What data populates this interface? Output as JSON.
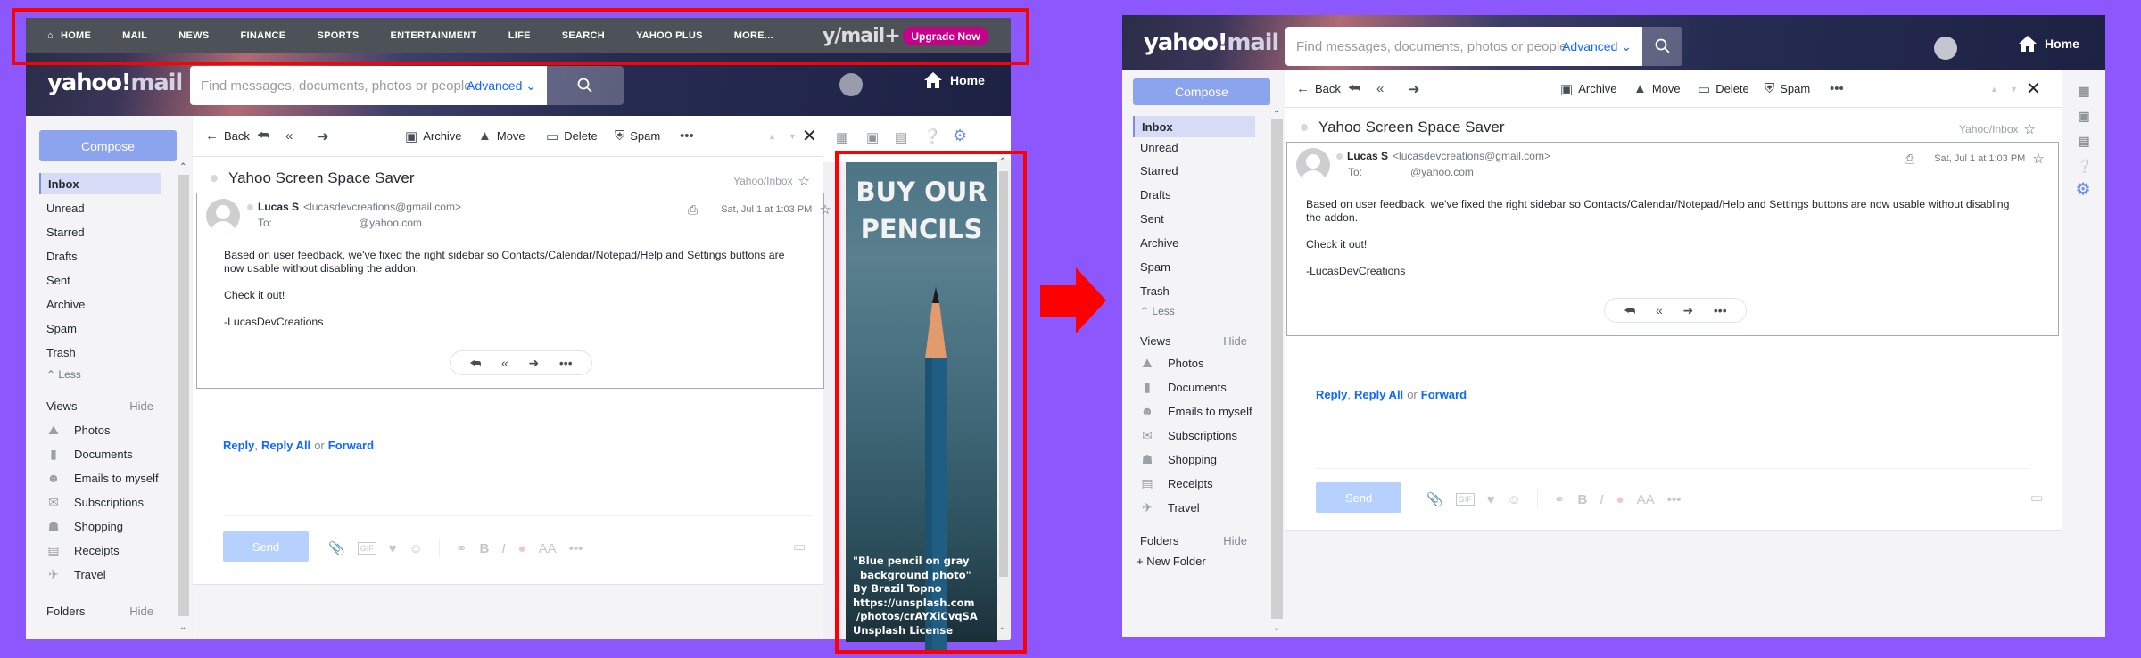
{
  "before": {
    "topnav": {
      "items": [
        "HOME",
        "MAIL",
        "NEWS",
        "FINANCE",
        "SPORTS",
        "ENTERTAINMENT",
        "LIFE",
        "SEARCH",
        "YAHOO PLUS",
        "MORE..."
      ],
      "mail_plus_logo": "y/mail+",
      "upgrade_label": "Upgrade Now"
    },
    "header": {
      "logo_left": "yahoo!",
      "logo_right": "mail",
      "search_placeholder": "Find messages, documents, photos or people",
      "advanced_label": "Advanced",
      "home_label": "Home"
    },
    "ad": {
      "headline_line1": "BUY OUR",
      "headline_line2": "PENCILS",
      "caption": "\"Blue pencil on gray\n  background photo\"\nBy Brazil Topno\nhttps://unsplash.com\n /photos/crAYXiCvqSA\nUnsplash License"
    }
  },
  "after": {
    "header": {
      "logo_left": "yahoo!",
      "logo_right": "mail",
      "search_placeholder": "Find messages, documents, photos or people",
      "advanced_label": "Advanced",
      "home_label": "Home"
    },
    "new_folder_label": "+ New Folder"
  },
  "sidebar": {
    "compose_label": "Compose",
    "folders": [
      "Inbox",
      "Unread",
      "Starred",
      "Drafts",
      "Sent",
      "Archive",
      "Spam",
      "Trash"
    ],
    "selected_folder": "Inbox",
    "less_label": "Less",
    "views_label": "Views",
    "hide_label": "Hide",
    "views": [
      {
        "label": "Photos",
        "icon": "photos-icon"
      },
      {
        "label": "Documents",
        "icon": "document-icon"
      },
      {
        "label": "Emails to myself",
        "icon": "person-icon"
      },
      {
        "label": "Subscriptions",
        "icon": "subscriptions-icon"
      },
      {
        "label": "Shopping",
        "icon": "shopping-bag-icon"
      },
      {
        "label": "Receipts",
        "icon": "receipt-icon"
      },
      {
        "label": "Travel",
        "icon": "airplane-icon"
      }
    ],
    "folders_label": "Folders"
  },
  "toolbar": {
    "back_label": "Back",
    "archive_label": "Archive",
    "move_label": "Move",
    "delete_label": "Delete",
    "spam_label": "Spam"
  },
  "message": {
    "subject": "Yahoo Screen Space Saver",
    "folder_path": "Yahoo/Inbox",
    "sender_name": "Lucas S",
    "sender_email": "<lucasdevcreations@gmail.com>",
    "to_label": "To:",
    "to_address": "@yahoo.com",
    "date": "Sat, Jul 1 at 1:03 PM",
    "body_p1": "Based on user feedback, we've fixed the right sidebar so Contacts/Calendar/Notepad/Help and Settings buttons are now usable without disabling the addon.",
    "body_p2": "Check it out!",
    "body_p3": "-LucasDevCreations"
  },
  "reply": {
    "reply_label": "Reply",
    "reply_all_label": "Reply All",
    "or_label": "or",
    "forward_label": "Forward",
    "send_label": "Send"
  },
  "colors": {
    "background": "#8c57fd",
    "highlight": "#ff0000",
    "compose": "#8ca3ee",
    "link": "#0f69ff",
    "upgrade": "#c7008b",
    "settings": "#6e8ef0"
  }
}
